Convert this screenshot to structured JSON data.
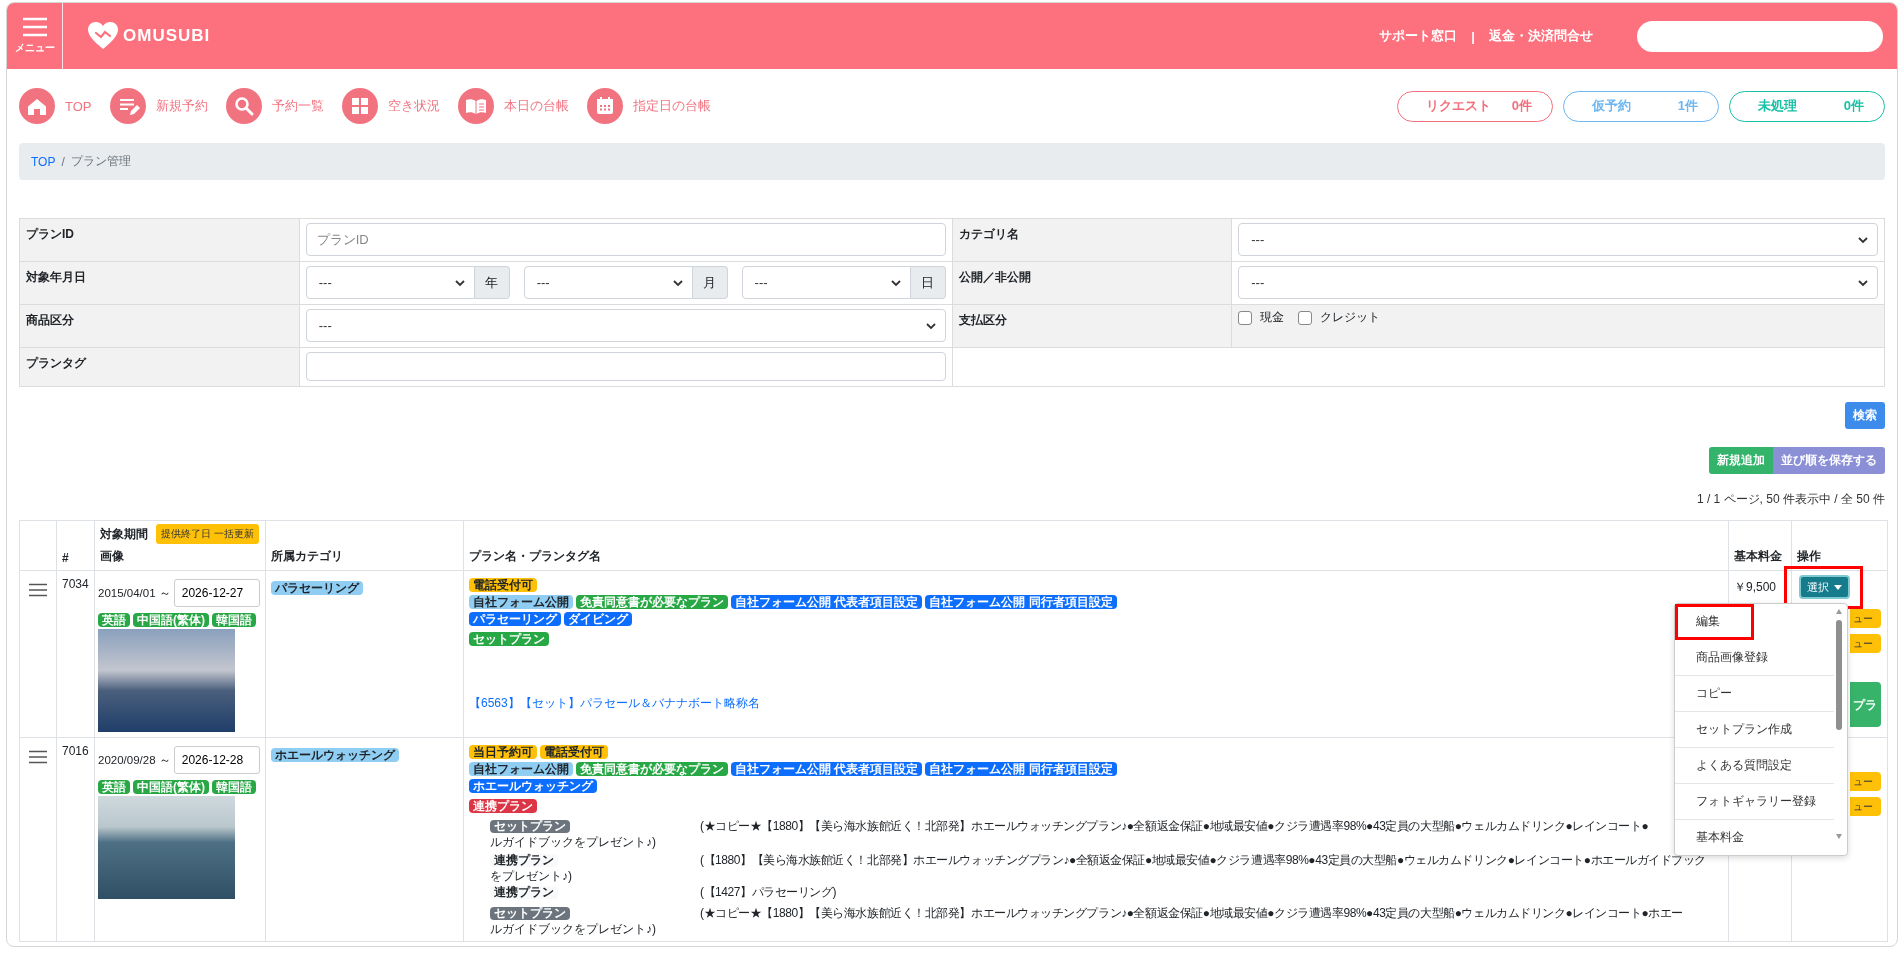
{
  "header": {
    "menu_label": "メニュー",
    "logo_text": "OMUSUBI",
    "links": [
      "サポート窓口",
      "返金・決済問合せ"
    ],
    "separator": "|"
  },
  "nav": [
    {
      "label": "TOP",
      "kind": "home"
    },
    {
      "label": "新規予約",
      "kind": "edit"
    },
    {
      "label": "予約一覧",
      "kind": "search"
    },
    {
      "label": "空き状況",
      "kind": "grid"
    },
    {
      "label": "本日の台帳",
      "kind": "book"
    },
    {
      "label": "指定日の台帳",
      "kind": "calendar"
    }
  ],
  "counters": [
    {
      "label": "リクエスト",
      "count": "0件",
      "color": "#f36f7c"
    },
    {
      "label": "仮予約",
      "count": "1件",
      "color": "#6cb6f2"
    },
    {
      "label": "未処理",
      "count": "0件",
      "color": "#17c1a6"
    }
  ],
  "breadcrumb": {
    "separator": "/",
    "items": [
      {
        "label": "TOP",
        "link": true
      },
      {
        "label": "プラン管理",
        "link": false
      }
    ]
  },
  "filters": [
    {
      "label": "プランID",
      "kind": "text",
      "placeholder": "プランID"
    },
    {
      "label": "カテゴリ名",
      "kind": "select",
      "value": "---"
    },
    {
      "label": "対象年月日",
      "kind": "date",
      "parts": [
        {
          "value": "---",
          "unit": "年"
        },
        {
          "value": "---",
          "unit": "月"
        },
        {
          "value": "---",
          "unit": "日"
        }
      ]
    },
    {
      "label": "公開／非公開",
      "kind": "select",
      "value": "---"
    },
    {
      "label": "商品区分",
      "kind": "select",
      "value": "---"
    },
    {
      "label": "支払区分",
      "kind": "checks",
      "options": [
        {
          "label": "現金",
          "checked": false
        },
        {
          "label": "クレジット",
          "checked": false
        }
      ]
    },
    {
      "label": "プランタグ",
      "kind": "text"
    }
  ],
  "search_button": "検索",
  "add_button": "新規追加",
  "save_order_button": "並び順を保存する",
  "pagination": "1 / 1 ページ, 50 件表示中 / 全 50 件",
  "table": {
    "columns": {
      "number": "#",
      "period": "対象期間",
      "bulk_update_button": "提供終了日 一括更新",
      "image": "画像",
      "category": "所属カテゴリ",
      "plan": "プラン名・プランタグ名",
      "price": "基本料金",
      "actions": "操作"
    },
    "rows": [
      {
        "id": "7034",
        "start": "2015/04/01 ～",
        "end": "2026-12-27",
        "languages": [
          "英語",
          "中国語(繁体)",
          "韓国語"
        ],
        "category": "パラセーリング",
        "tag_lines": [
          [
            {
              "label": "電話受付可",
              "color": "#ffc107"
            }
          ],
          [
            {
              "label": "自社フォーム公開",
              "color": "#8fcdf3"
            },
            {
              "label": "免責同意書が必要なプラン",
              "color": "#28a745"
            },
            {
              "label": "自社フォーム公開 代表者項目設定",
              "color": "#0d6efd"
            },
            {
              "label": "自社フォーム公開 同行者項目設定",
              "color": "#0d6efd"
            }
          ],
          [
            {
              "label": "パラセーリング",
              "color": "#0d6efd"
            },
            {
              "label": "ダイビング",
              "color": "#0d6efd"
            }
          ]
        ],
        "plan_badge": {
          "label": "セットプラン",
          "color": "#28a745"
        },
        "links": [
          "【6563】【セット】パラセール＆バナナボート略称名"
        ],
        "price": "￥9,500",
        "action_button": "選択",
        "extra_buttons": [
          {
            "label": "ュー",
            "color": "#ffc107"
          },
          {
            "label": "ュー",
            "color": "#ffc107"
          },
          {
            "label": "プラ",
            "color": "#38b36a"
          }
        ]
      },
      {
        "id": "7016",
        "start": "2020/09/28 ～",
        "end": "2026-12-28",
        "languages": [
          "英語",
          "中国語(繁体)",
          "韓国語"
        ],
        "category": "ホエールウォッチング",
        "tag_lines": [
          [
            {
              "label": "当日予約可",
              "color": "#ffc107"
            },
            {
              "label": "電話受付可",
              "color": "#ffc107"
            }
          ],
          [
            {
              "label": "自社フォーム公開",
              "color": "#8fcdf3"
            },
            {
              "label": "免責同意書が必要なプラン",
              "color": "#28a745"
            },
            {
              "label": "自社フォーム公開 代表者項目設定",
              "color": "#0d6efd"
            },
            {
              "label": "自社フォーム公開 同行者項目設定",
              "color": "#0d6efd"
            }
          ],
          [
            {
              "label": "ホエールウォッチング",
              "color": "#0d6efd"
            }
          ]
        ],
        "plan_badge": {
          "label": "連携プラン",
          "color": "#dc3545"
        },
        "related": [
          {
            "badge": "セットプラン",
            "color": "#6c757d",
            "text": "(★コピー★【1880】【美ら海水族館近く！北部発】ホエールウォッチングプラン♪●全額返金保証●地域最安値●クジラ遭遇率98%●43定員の大型船●ウェルカムドリンク●レインコート●",
            "continuation": "ルガイドブックをプレゼント♪)"
          },
          {
            "badge": "連携プラン",
            "color": "#f8f9fa",
            "text": "(【1880】【美ら海水族館近く！北部発】ホエールウォッチングプラン♪●全額返金保証●地域最安値●クジラ遭遇率98%●43定員の大型船●ウェルカムドリンク●レインコート●ホエールガイドブック",
            "continuation": "をプレゼント♪)"
          },
          {
            "badge": "連携プラン",
            "color": "#f8f9fa",
            "text": "(【1427】パラセーリング)"
          },
          {
            "badge": "セットプラン",
            "color": "#6c757d",
            "text": "(★コピー★【1880】【美ら海水族館近く！北部発】ホエールウォッチングプラン♪●全額返金保証●地域最安値●クジラ遭遇率98%●43定員の大型船●ウェルカムドリンク●レインコート●ホエー",
            "continuation": "ルガイドブックをプレゼント♪)"
          }
        ],
        "extra_buttons": [
          {
            "label": "ュー",
            "color": "#ffc107"
          },
          {
            "label": "ュー",
            "color": "#ffc107"
          }
        ]
      }
    ]
  },
  "action_menu": {
    "items": [
      {
        "label": "編集",
        "highlighted": true
      },
      {
        "label": "商品画像登録",
        "highlighted": false
      },
      {
        "label": "コピー",
        "highlighted": false
      },
      {
        "label": "セットプラン作成",
        "highlighted": false
      },
      {
        "label": "よくある質問設定",
        "highlighted": false
      },
      {
        "label": "フォトギャラリー登録",
        "highlighted": false
      },
      {
        "label": "基本料金",
        "highlighted": false
      }
    ]
  }
}
